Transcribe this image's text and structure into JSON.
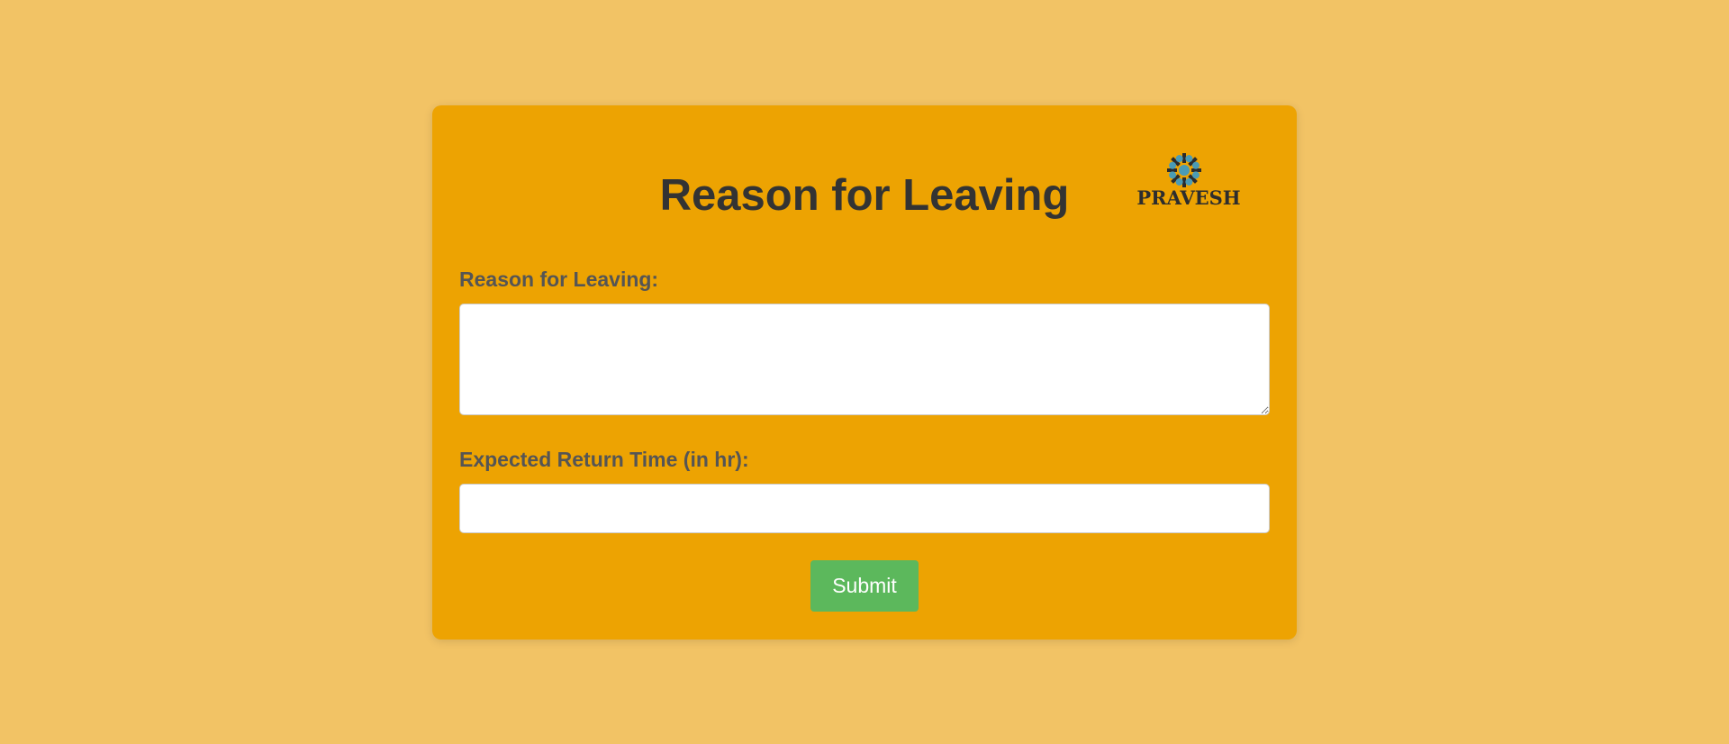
{
  "form": {
    "title": "Reason for Leaving",
    "logo_text": "PRAVESH",
    "reason_label": "Reason for Leaving:",
    "reason_value": "",
    "time_label": "Expected Return Time (in hr):",
    "time_value": "",
    "submit_label": "Submit"
  },
  "colors": {
    "page_background": "#f2c365",
    "card_background": "#eda302",
    "title_text": "#333333",
    "label_text": "#555555",
    "submit_button": "#5cb85c",
    "logo_mark": "#4a9bb5"
  },
  "icons": {
    "logo": "pravesh-logo-icon"
  }
}
